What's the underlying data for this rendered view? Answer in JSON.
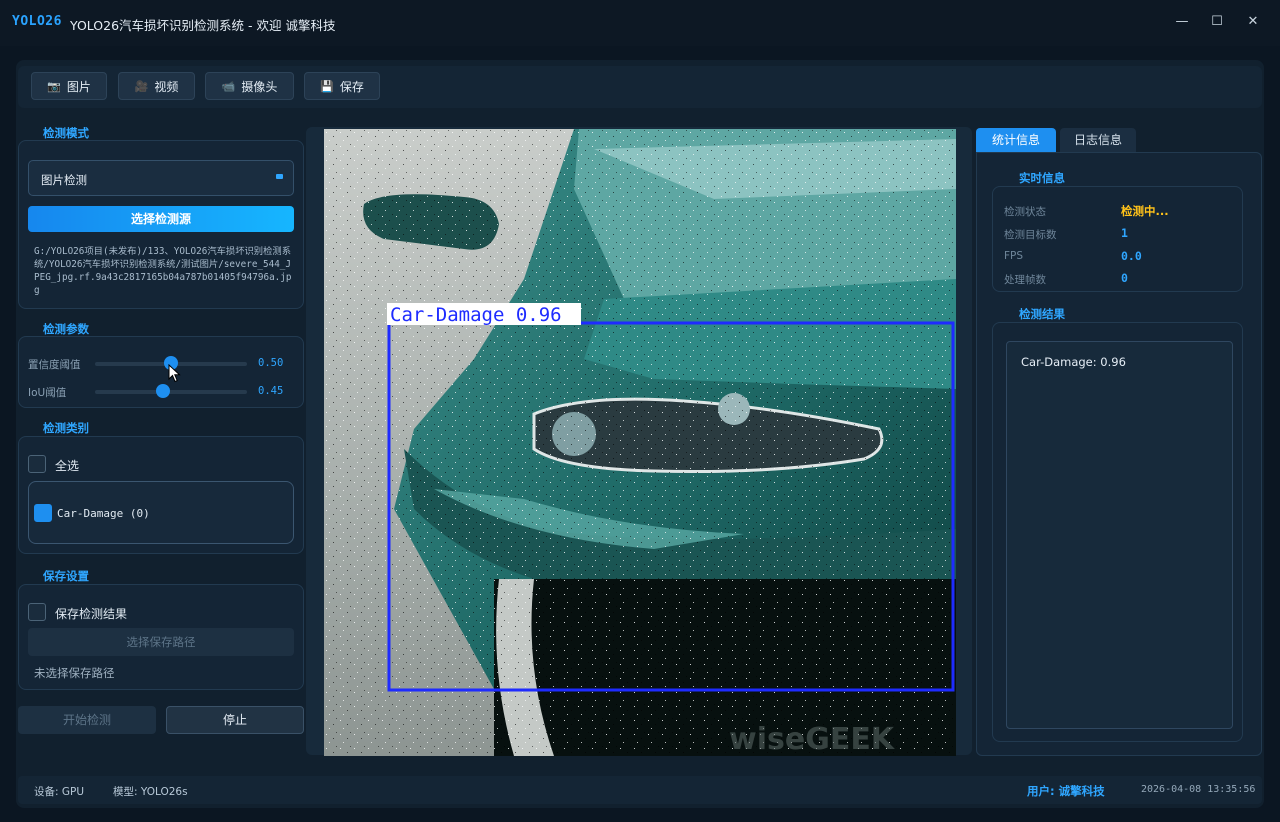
{
  "window": {
    "logo": "YOLO26",
    "title": "YOLO26汽车损坏识别检测系统 - 欢迎 诚擎科技",
    "minimize": "—",
    "maximize": "☐",
    "close": "✕"
  },
  "toolbar": {
    "image_label": "图片",
    "video_label": "视频",
    "camera_label": "摄像头",
    "save_label": "保存"
  },
  "detection_mode": {
    "title": "检测模式",
    "selected": "图片检测",
    "choose_source_label": "选择检测源",
    "source_path": "G:/YOLO26项目(未发布)/133、YOLO26汽车损坏识别检测系统/YOLO26汽车损坏识别检测系统/测试图片/severe_544_JPEG_jpg.rf.9a43c2817165b04a787b01405f94796a.jpg"
  },
  "detection_params": {
    "title": "检测参数",
    "confidence": {
      "label": "置信度阈值",
      "value": "0.50",
      "fraction": 0.5
    },
    "iou": {
      "label": "IoU阈值",
      "value": "0.45",
      "fraction": 0.45
    }
  },
  "detection_classes": {
    "title": "检测类别",
    "select_all_label": "全选",
    "select_all_checked": false,
    "items": [
      {
        "label": "Car-Damage (0)",
        "checked": true
      }
    ]
  },
  "save_settings": {
    "title": "保存设置",
    "save_results_label": "保存检测结果",
    "save_results_checked": false,
    "choose_path_label": "选择保存路径",
    "path_status": "未选择保存路径"
  },
  "actions": {
    "start_label": "开始检测",
    "stop_label": "停止"
  },
  "image_view": {
    "detection_label": "Car-Damage 0.96",
    "watermark": "wiseGEEK",
    "box_color": "#1e2bff"
  },
  "right_tabs": {
    "stats_label": "统计信息",
    "log_label": "日志信息"
  },
  "realtime_info": {
    "title": "实时信息",
    "status_key": "检测状态",
    "status_value": "检测中...",
    "targets_key": "检测目标数",
    "targets_value": "1",
    "fps_key": "FPS",
    "fps_value": "0.0",
    "frames_key": "处理帧数",
    "frames_value": "0"
  },
  "detection_results": {
    "title": "检测结果",
    "items": [
      "Car-Damage: 0.96"
    ]
  },
  "statusbar": {
    "device": "设备: GPU",
    "model": "模型: YOLO26s",
    "user": "用户: 诚擎科技",
    "datetime": "2026-04-08 13:35:56"
  },
  "colors": {
    "accent": "#1e8ff0",
    "status_warning": "#ffc21a"
  }
}
